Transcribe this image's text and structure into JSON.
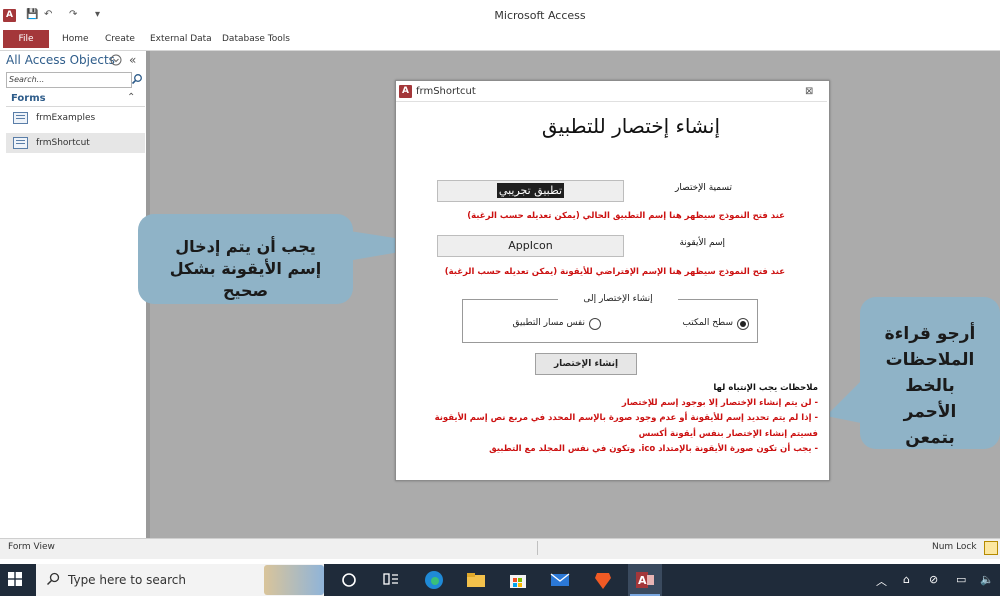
{
  "window": {
    "title": "Microsoft Access",
    "logo_letter": "A",
    "quick_access": [
      "💾",
      "↶",
      "↷",
      "▾"
    ]
  },
  "ribbon": {
    "file": "File",
    "tabs": [
      "Home",
      "Create",
      "External Data",
      "Database Tools"
    ]
  },
  "nav": {
    "header": "All Access Objects",
    "search_placeholder": "Search...",
    "group": "Forms",
    "items": [
      "frmExamples",
      "frmShortcut"
    ]
  },
  "form": {
    "title": "frmShortcut",
    "heading": "إنشاء إختصار للتطبيق",
    "shortcut_name_label": "تسمية الإختصار",
    "shortcut_name_value": "تطبيق تجريبي",
    "note_shortcut": "عند فتح النموذج سيظهر هنا إسم التطبيق الحالي (يمكن تعديله حسب الرغبة)",
    "icon_name_label": "إسم الأيقونة",
    "icon_name_value": "AppIcon",
    "note_icon": "عند فتح النموذج سيظهر هنا الإسم الإفتراضي للأيقونة (يمكن تعديله حسب الرغبة)",
    "group_title": "إنشاء الإختصار إلى",
    "option_desktop": "سطح المكتب",
    "option_app_path": "نفس مسار التطبيق",
    "selected_option": "desktop",
    "create_button": "إنشاء الإختصار",
    "notes_title": "ملاحظات يجب الإنتباه لها",
    "notes": [
      "- لن يتم إنشاء الإختصار إلا بوجود إسم للإختصار",
      "- إذا لم يتم تحديد إسم للأيقونة أو عدم وجود صورة بالإسم المحدد في مربع نص إسم الأيقونة",
      "فسيتم إنشاء الإختصار بنفس أيقونة أكسس",
      "- يجب أن تكون صورة الأيقونة بالإمتداد ico. وتكون في نفس المجلد مع التطبيق"
    ]
  },
  "callouts": {
    "left": "يجب أن يتم إدخال إسم الأيقونة بشكل صحيح",
    "right": "أرجو قراءة الملاحظات بالخط الأحمر بتمعن"
  },
  "status": {
    "left": "Form View",
    "right": "Num Lock"
  },
  "taskbar": {
    "search_placeholder": "Type here to search"
  },
  "colors": {
    "access_red": "#a4373a",
    "note_red": "#cc1111",
    "callout": "#8fb3c7",
    "taskbar": "#1f2b3a"
  }
}
